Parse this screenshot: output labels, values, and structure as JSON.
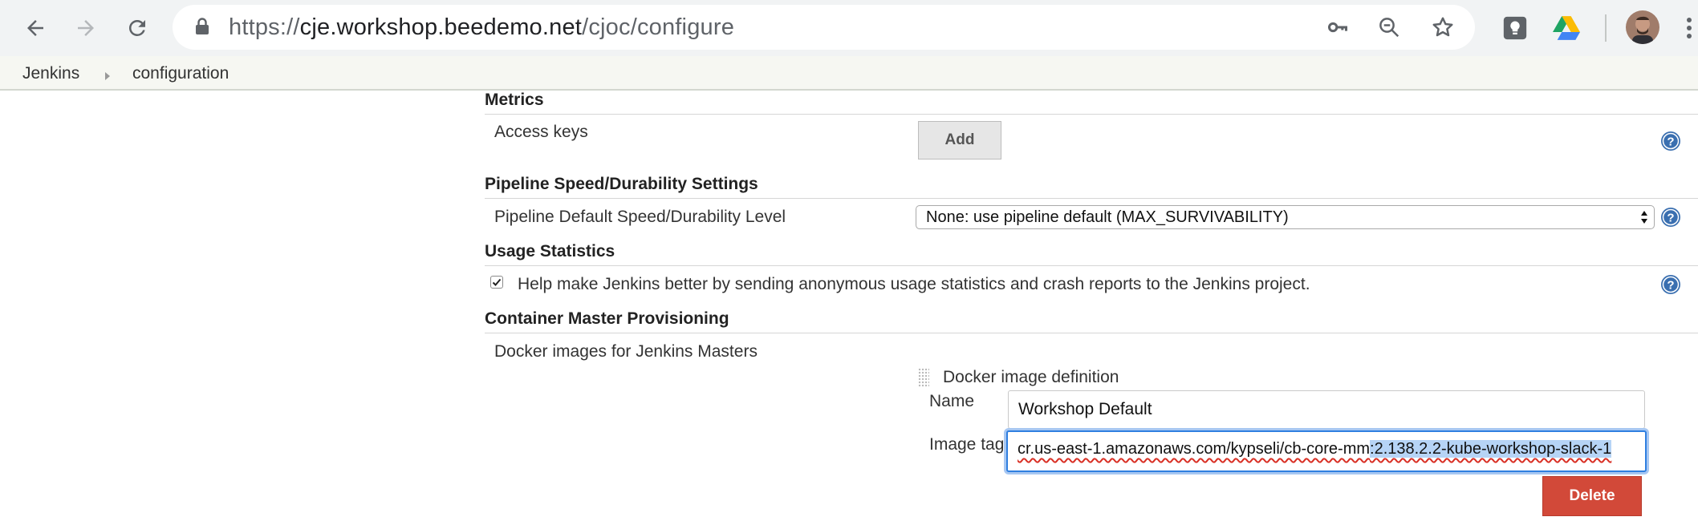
{
  "browser": {
    "url_scheme": "https://",
    "url_host": "cje.workshop.beedemo.net",
    "url_path": "/cjoc/configure",
    "icons": [
      "back-icon",
      "forward-icon",
      "reload-icon",
      "lock-icon",
      "key-icon",
      "zoom-out-icon",
      "star-icon",
      "lightbulb-extension-icon",
      "google-drive-icon",
      "profile-avatar",
      "menu-icon"
    ]
  },
  "breadcrumb": {
    "items": [
      "Jenkins",
      "configuration"
    ]
  },
  "sections": {
    "metrics": {
      "title": "Metrics",
      "access_keys_label": "Access keys",
      "add_button": "Add"
    },
    "pipeline": {
      "title": "Pipeline Speed/Durability Settings",
      "level_label": "Pipeline Default Speed/Durability Level",
      "level_value": "None: use pipeline default (MAX_SURVIVABILITY)"
    },
    "usage": {
      "title": "Usage Statistics",
      "checkbox_checked": true,
      "checkbox_label": "Help make Jenkins better by sending anonymous usage statistics and crash reports to the Jenkins project."
    },
    "container": {
      "title": "Container Master Provisioning",
      "docker_images_label": "Docker images for Jenkins Masters",
      "definition_title": "Docker image definition",
      "name_label": "Name",
      "name_value": "Workshop Default",
      "image_tag_label": "Image tag",
      "image_tag_value_plain": "cr.us-east-1.amazonaws.com/kypseli/cb-core-mm",
      "image_tag_value_selected": ":2.138.2.2-kube-workshop-slack-1",
      "delete_button": "Delete"
    }
  },
  "colors": {
    "delete": "#d24939",
    "focus": "#2f7fe0",
    "help": "#3a6fb0"
  }
}
